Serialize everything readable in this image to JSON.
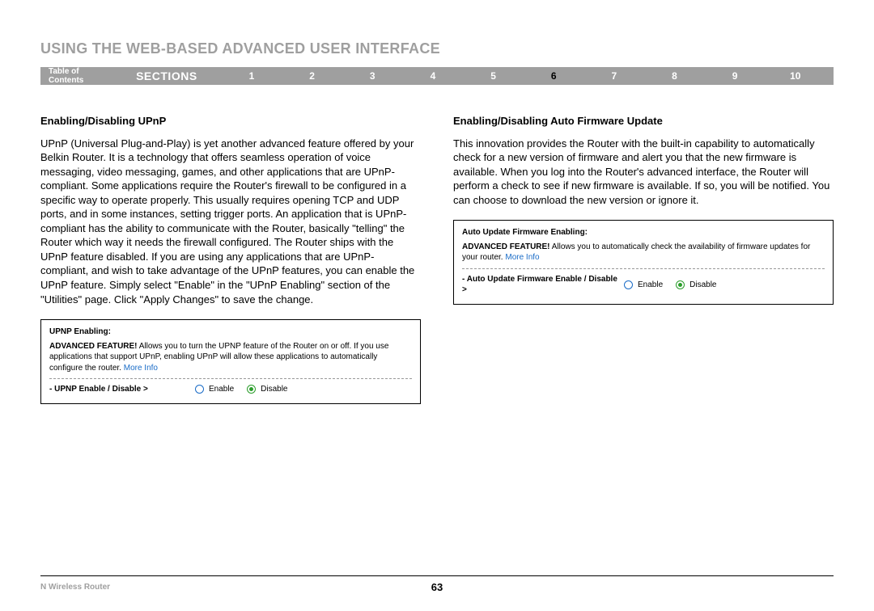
{
  "header": {
    "title": "USING THE WEB-BASED ADVANCED USER INTERFACE"
  },
  "nav": {
    "toc": "Table of Contents",
    "sections_label": "SECTIONS",
    "items": [
      "1",
      "2",
      "3",
      "4",
      "5",
      "6",
      "7",
      "8",
      "9",
      "10"
    ],
    "active_index": 5
  },
  "left": {
    "heading": "Enabling/Disabling UPnP",
    "body": "UPnP (Universal Plug-and-Play) is yet another advanced feature offered by your Belkin Router. It is a technology that offers seamless operation of voice messaging, video messaging, games, and other applications that are UPnP-compliant. Some applications require the Router's firewall to be configured in a specific way to operate properly. This usually requires opening TCP and UDP ports, and in some instances, setting trigger ports. An application that is UPnP-compliant has the ability to communicate with the Router, basically \"telling\" the Router which way it needs the firewall configured. The Router ships with the UPnP feature disabled. If you are using any applications that are UPnP-compliant, and wish to take advantage of the UPnP features, you can enable the UPnP feature. Simply select \"Enable\" in the \"UPnP Enabling\" section of the \"Utilities\" page. Click \"Apply Changes\" to save the change.",
    "panel": {
      "title": "UPNP Enabling:",
      "desc_bold": "ADVANCED FEATURE!",
      "desc_rest": " Allows you to turn the UPNP feature of the Router on or off. If you use applications that support UPnP, enabling UPnP will allow these applications to automatically configure the router. ",
      "more": "More Info",
      "row_label": "- UPNP Enable / Disable >",
      "opt_enable": "Enable",
      "opt_disable": "Disable",
      "selected": "disable"
    }
  },
  "right": {
    "heading": "Enabling/Disabling Auto Firmware Update",
    "body": "This innovation provides the Router with the built-in capability to automatically check for a new version of firmware and alert you that the new firmware is available. When you log into the Router's advanced interface, the Router will perform a check to see if new firmware is available. If so, you will be notified. You can choose to download the new version or ignore it.",
    "panel": {
      "title": "Auto Update Firmware Enabling:",
      "desc_bold": "ADVANCED FEATURE!",
      "desc_rest": " Allows you to automatically check the availability of firmware updates for your router. ",
      "more": "More Info",
      "row_label": "- Auto Update Firmware Enable / Disable >",
      "opt_enable": "Enable",
      "opt_disable": "Disable",
      "selected": "disable"
    }
  },
  "footer": {
    "product": "N Wireless Router",
    "page": "63"
  }
}
